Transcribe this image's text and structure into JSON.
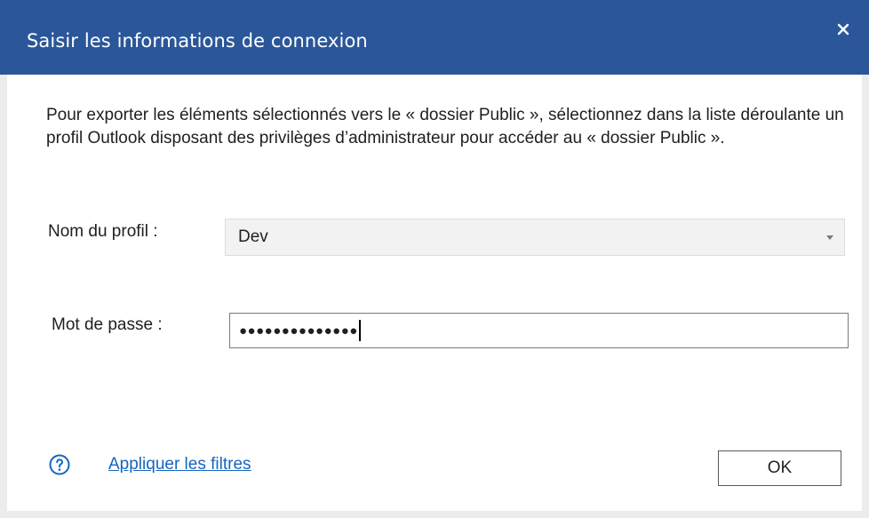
{
  "window": {
    "title": "Saisir les informations de connexion",
    "close_icon": "close-icon"
  },
  "intro_text": "Pour exporter les éléments sélectionnés vers le « dossier Public », sélectionnez dans la liste déroulante un profil Outlook disposant des privilèges d’administrateur pour accéder au « dossier Public ».",
  "form": {
    "profile_label": "Nom du profil :",
    "profile_value": "Dev",
    "password_label": "Mot de passe :",
    "password_mask": "●●●●●●●●●●●●●●"
  },
  "footer": {
    "help_icon": "help-icon",
    "filters_link": "Appliquer les filtres",
    "ok_label": "OK"
  },
  "colors": {
    "titlebar": "#2b579a",
    "link": "#1565c0"
  }
}
